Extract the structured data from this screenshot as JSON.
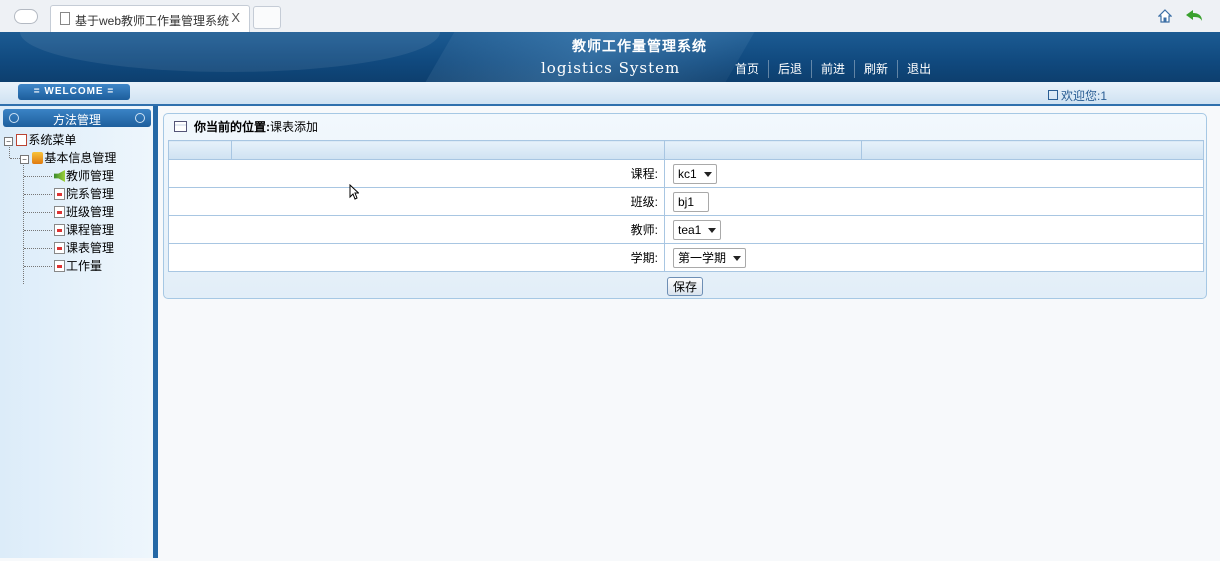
{
  "browser": {
    "tab_title": "基于web教师工作量管理系统",
    "tab_close": "X"
  },
  "header": {
    "title": "教师工作量管理系统",
    "subtitle": "logistics System",
    "nav": [
      "首页",
      "后退",
      "前进",
      "刷新",
      "退出"
    ]
  },
  "welcome_bar": {
    "welcome_label": "= WELCOME =",
    "greeting": "欢迎您:1"
  },
  "sidebar": {
    "heading": "方法管理",
    "root": "系统菜单",
    "group": "基本信息管理",
    "items": [
      "教师管理",
      "院系管理",
      "班级管理",
      "课程管理",
      "课表管理",
      "工作量"
    ]
  },
  "main": {
    "location_label": "你当前的位置:",
    "location_value": "课表添加",
    "fields": [
      {
        "label": "课程:",
        "value": "kc1",
        "type": "select"
      },
      {
        "label": "班级:",
        "value": "bj1",
        "type": "input"
      },
      {
        "label": "教师:",
        "value": "tea1",
        "type": "select"
      },
      {
        "label": "学期:",
        "value": "第一学期",
        "type": "select"
      }
    ],
    "save_label": "保存"
  },
  "colors": {
    "banner": "#10497e",
    "accent": "#2468a6",
    "panel_border": "#a6c8e4"
  }
}
